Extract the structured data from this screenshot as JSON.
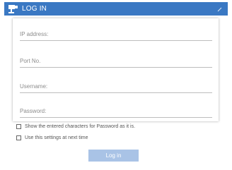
{
  "window": {
    "title": "LOG IN",
    "app_icon": "camera-device-icon",
    "close_icon": "close-x-icon"
  },
  "form": {
    "ip_address_label": "IP address:",
    "port_label": "Port No.",
    "username_label": "Username:",
    "password_label": "Password:"
  },
  "options": {
    "show_password_label": "Show the entered characters for Password as it is.",
    "use_settings_label": "Use this settings at next time"
  },
  "actions": {
    "login_label": "Log in"
  },
  "colors": {
    "titlebar": "#3a78c3",
    "login_button": "#a9c3e6"
  }
}
